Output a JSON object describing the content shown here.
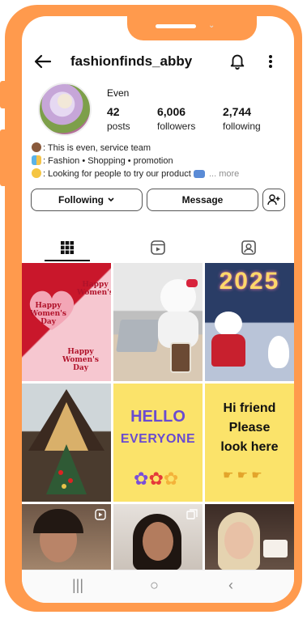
{
  "header": {
    "username": "fashionfinds_abby"
  },
  "profile": {
    "display_name": "Even",
    "stats": [
      {
        "value": "42",
        "label": "posts"
      },
      {
        "value": "6,006",
        "label": "followers"
      },
      {
        "value": "2,744",
        "label": "following"
      }
    ],
    "bio": [
      "This is even, service team",
      "Fashion • Shopping • promotion",
      "Looking for people to try our product"
    ],
    "bio_more": "... more"
  },
  "actions": {
    "following_label": "Following",
    "message_label": "Message"
  },
  "tabs": [
    "grid-icon",
    "reels-icon",
    "tagged-icon"
  ],
  "grid": {
    "post1_text": [
      "Happy",
      "Women's",
      "Day"
    ],
    "post3_text": "2025",
    "post5_text": [
      "HELLO",
      "EVERYONE"
    ],
    "post6_text": [
      "Hi friend",
      "Please",
      "look here"
    ]
  },
  "colors": {
    "frame": "#ff9a4d",
    "accent_yellow": "#fbe36a",
    "pink": "#f3b9c4"
  }
}
